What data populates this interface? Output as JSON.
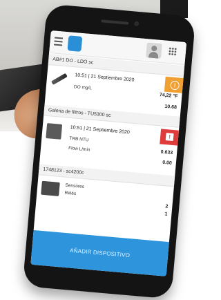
{
  "colors": {
    "accent": "#2e95dc",
    "warning": "#f0a032",
    "error": "#e03b3b"
  },
  "icons": {
    "menu": "menu-icon",
    "logo": "app-logo-icon",
    "user": "user-icon",
    "apps": "grid-icon",
    "warning": "warning-icon",
    "error": "error-icon"
  },
  "devices": [
    {
      "title": "AB#1 DO - LDO sc",
      "time": "10:51 | 21 Septiembre 2020",
      "status": "warning",
      "params": [
        {
          "label": "DO mg/L",
          "value": "74,22 °F"
        },
        {
          "label": "",
          "value": "10.68"
        }
      ]
    },
    {
      "title": "Galeria de filtros - TU5300 sc",
      "time": "10:51 | 21 Septiembre 2020",
      "status": "error",
      "params": [
        {
          "label": "TRB NTU",
          "value": "0.633"
        },
        {
          "label": "Flow L/min",
          "value": "0.00"
        }
      ]
    },
    {
      "title": "1748123 - sc4200c",
      "params": [
        {
          "label": "Sensores",
          "value": "2"
        },
        {
          "label": "Relés",
          "value": "1"
        }
      ]
    }
  ],
  "add_button": "AÑADIR DISPOSITIVO"
}
